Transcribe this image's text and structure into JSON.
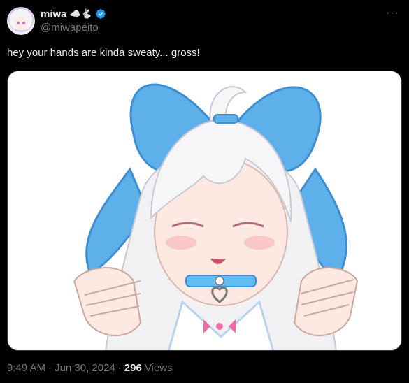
{
  "author": {
    "name": "miwa",
    "emoji": "☁️🐇",
    "handle": "@miwapeito",
    "verified": true
  },
  "menu_label": "···",
  "tweet_text": "hey your hands are kinda sweaty... gross!",
  "meta": {
    "time": "9:49 AM",
    "separator1": "·",
    "date": "Jun 30, 2024",
    "separator2": "·",
    "views_count": "296",
    "views_label": "Views"
  },
  "colors": {
    "background": "#000000",
    "text": "#e7e9ea",
    "muted": "#71767b",
    "verified": "#1d9bf0",
    "bow": "#5eb0ea"
  }
}
